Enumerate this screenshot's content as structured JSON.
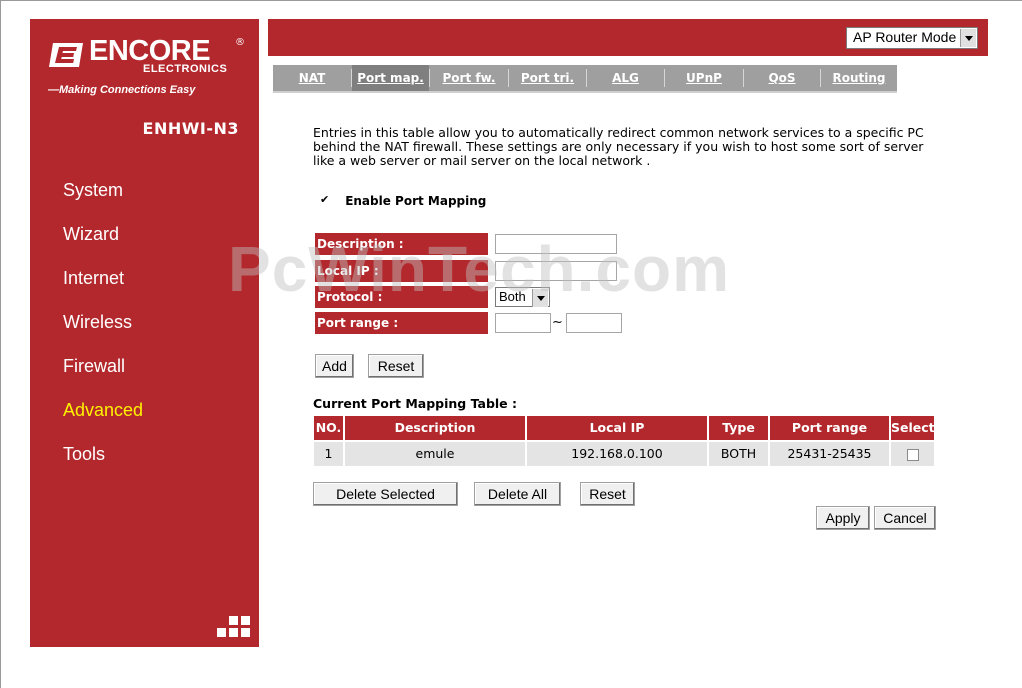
{
  "brand": {
    "logo_main": "ENCORE",
    "logo_registered": "®",
    "logo_sub": "ELECTRONICS",
    "tagline": "—Making Connections Easy",
    "model": "ENHWI-N3"
  },
  "sidebar": {
    "items": [
      {
        "label": "System"
      },
      {
        "label": "Wizard"
      },
      {
        "label": "Internet"
      },
      {
        "label": "Wireless"
      },
      {
        "label": "Firewall"
      },
      {
        "label": "Advanced"
      },
      {
        "label": "Tools"
      }
    ],
    "active_item": "Advanced"
  },
  "mode_selector": {
    "selected": "AP Router Mode"
  },
  "tabs": [
    {
      "label": "NAT"
    },
    {
      "label": "Port map."
    },
    {
      "label": "Port fw."
    },
    {
      "label": "Port tri."
    },
    {
      "label": "ALG"
    },
    {
      "label": "UPnP"
    },
    {
      "label": "QoS"
    },
    {
      "label": "Routing"
    }
  ],
  "active_tab": "Port map.",
  "intro_text": "Entries in this table allow you to automatically redirect common network services to a specific PC behind the NAT firewall. These settings are only necessary if you wish to host some sort of server like a web server or mail server on the local network .",
  "enable_port_mapping": {
    "label": "Enable Port Mapping",
    "checked": true
  },
  "form": {
    "description_label": "Description :",
    "description_value": "",
    "local_ip_label": "Local IP :",
    "local_ip_value": "",
    "protocol_label": "Protocol :",
    "protocol_value": "Both",
    "port_range_label": "Port range :",
    "port_from": "",
    "port_to": "",
    "range_separator": "~"
  },
  "form_buttons": {
    "add": "Add",
    "reset": "Reset"
  },
  "table": {
    "title": "Current Port Mapping Table :",
    "headers": [
      "NO.",
      "Description",
      "Local IP",
      "Type",
      "Port range",
      "Select"
    ],
    "rows": [
      {
        "no": "1",
        "description": "emule",
        "local_ip": "192.168.0.100",
        "type": "BOTH",
        "port_range": "25431-25435",
        "selected": false
      }
    ]
  },
  "table_buttons": {
    "delete_selected": "Delete Selected",
    "delete_all": "Delete All",
    "reset": "Reset"
  },
  "footer_buttons": {
    "apply": "Apply",
    "cancel": "Cancel"
  },
  "watermark": "PcWinTech.com",
  "colors": {
    "brand_red": "#b3282d",
    "active_nav": "#fff200",
    "tab_bar": "#9f9f9f",
    "tab_active": "#7f7f7f",
    "cell_bg": "#e4e4e4"
  }
}
